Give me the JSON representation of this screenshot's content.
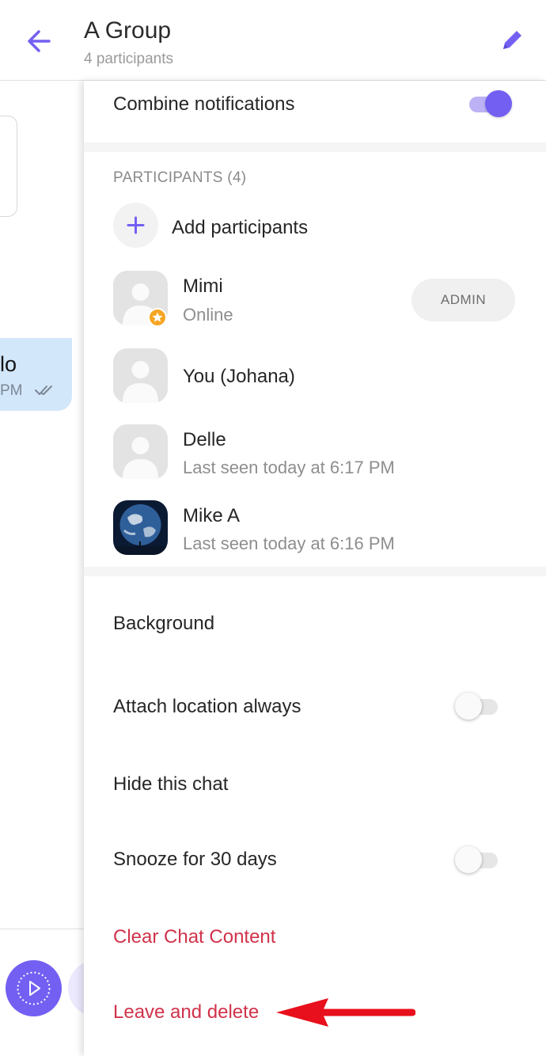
{
  "header": {
    "title": "A Group",
    "subtitle": "4 participants"
  },
  "chat_background": {
    "bubble_text": "lo",
    "bubble_time": "PM"
  },
  "panel": {
    "combine_notifications": {
      "label": "Combine notifications",
      "enabled": true
    },
    "participants_header": "PARTICIPANTS (4)",
    "add_participants_label": "Add participants",
    "participants": [
      {
        "name": "Mimi",
        "status": "Online",
        "badge": "ADMIN",
        "avatar": "default-avatar"
      },
      {
        "name": "You (Johana)",
        "status": "",
        "avatar": "default-avatar"
      },
      {
        "name": "Delle",
        "status": "Last seen today at 6:17 PM",
        "avatar": "default-avatar"
      },
      {
        "name": "Mike A",
        "status": "Last seen today at 6:16 PM",
        "avatar": "earth-photo"
      }
    ],
    "background_label": "Background",
    "attach_location": {
      "label": "Attach location always",
      "enabled": false
    },
    "hide_chat_label": "Hide this chat",
    "snooze": {
      "label": "Snooze for 30 days",
      "enabled": false
    },
    "clear_chat_label": "Clear Chat Content",
    "leave_delete_label": "Leave and delete"
  },
  "colors": {
    "accent": "#7360f2",
    "danger": "#d0334a",
    "annotation_arrow": "#e8101c",
    "admin_star": "#f6a623"
  }
}
